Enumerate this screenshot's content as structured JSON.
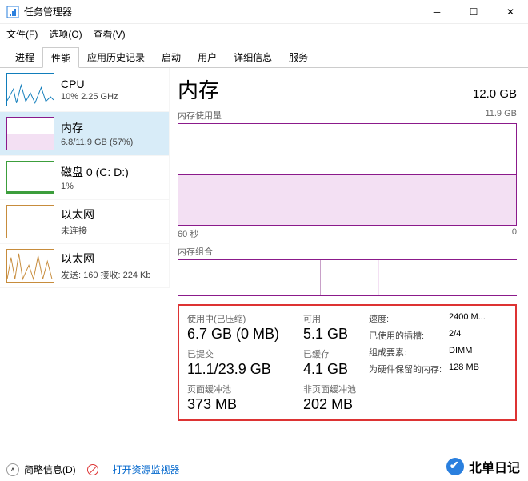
{
  "window": {
    "title": "任务管理器"
  },
  "menu": {
    "file": "文件(F)",
    "options": "选项(O)",
    "view": "查看(V)"
  },
  "tabs": [
    "进程",
    "性能",
    "应用历史记录",
    "启动",
    "用户",
    "详细信息",
    "服务"
  ],
  "sidebar": [
    {
      "title": "CPU",
      "sub": "10% 2.25 GHz"
    },
    {
      "title": "内存",
      "sub": "6.8/11.9 GB (57%)"
    },
    {
      "title": "磁盘 0 (C: D:)",
      "sub": "1%"
    },
    {
      "title": "以太网",
      "sub": "未连接"
    },
    {
      "title": "以太网",
      "sub": "发送: 160 接收: 224 Kb"
    }
  ],
  "main": {
    "title": "内存",
    "capacity": "12.0 GB",
    "usageLabel": "内存使用量",
    "usageRight": "11.9 GB",
    "timeLeft": "60 秒",
    "timeRight": "0",
    "compLabel": "内存组合"
  },
  "stats": {
    "col1": [
      {
        "lbl": "使用中(已压缩)",
        "val": "6.7 GB (0 MB)"
      },
      {
        "lbl": "已提交",
        "val": "11.1/23.9 GB"
      },
      {
        "lbl": "页面缓冲池",
        "val": "373 MB"
      }
    ],
    "col2": [
      {
        "lbl": "可用",
        "val": "5.1 GB"
      },
      {
        "lbl": "已缓存",
        "val": "4.1 GB"
      },
      {
        "lbl": "非页面缓冲池",
        "val": "202 MB"
      }
    ]
  },
  "spec": [
    {
      "k": "速度:",
      "v": "2400 M..."
    },
    {
      "k": "已使用的插槽:",
      "v": "2/4"
    },
    {
      "k": "组成要素:",
      "v": "DIMM"
    },
    {
      "k": "为硬件保留的内存:",
      "v": "128 MB"
    }
  ],
  "footer": {
    "fewer": "简略信息(D)",
    "resmon": "打开资源监视器"
  },
  "watermark": "北单日记",
  "chart_data": {
    "type": "area",
    "title": "内存使用量",
    "ylabel": "GB",
    "ylim": [
      0,
      11.9
    ],
    "x": [
      "60 秒",
      "0"
    ],
    "series": [
      {
        "name": "内存",
        "values": [
          6.8,
          6.8
        ]
      }
    ]
  }
}
